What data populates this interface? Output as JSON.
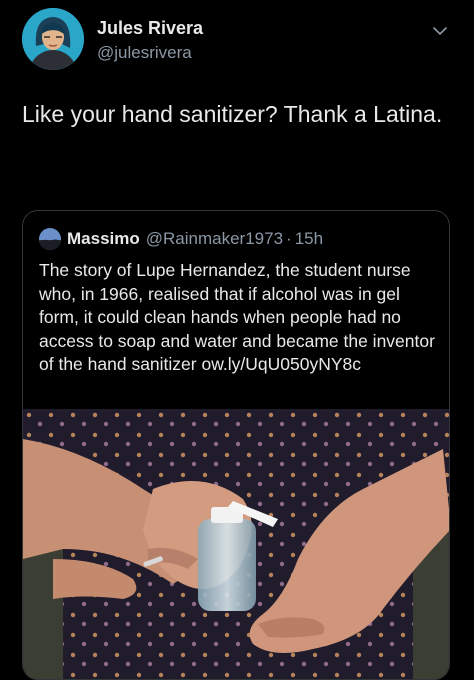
{
  "tweet": {
    "author_name": "Jules Rivera",
    "author_handle": "@julesrivera",
    "text": "Like your hand sanitizer? Thank a Latina."
  },
  "quoted": {
    "author_name": "Massimo",
    "author_handle": "@Rainmaker1973",
    "separator": "·",
    "time": "15h",
    "text": "The story of Lupe Hernandez, the student nurse who, in 1966, realised that if alcohol was in gel form, it could clean hands when people had no access to soap and water and became the inventor of the hand sanitizer ow.ly/UqU050yNY8c"
  },
  "icons": {
    "more": "chevron-down-icon"
  },
  "colors": {
    "background": "#000000",
    "text_primary": "#e7e9ea",
    "text_secondary": "#8b98a5",
    "border": "#333639"
  }
}
